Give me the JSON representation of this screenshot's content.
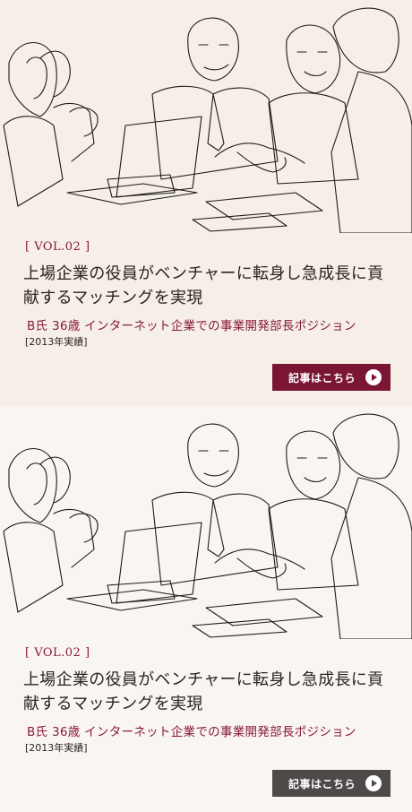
{
  "colors": {
    "accent": "#8a1a3a",
    "button_primary": "#7a1634",
    "button_secondary": "#4f4a49"
  },
  "cards": [
    {
      "vol": "[ VOL.02 ]",
      "title": "上場企業の役員がベンチャーに転身し急成長に貢献するマッチングを実現",
      "subtitle": "B氏 36歳 インターネット企業での事業開発部長ポジション",
      "year": "[2013年実績]",
      "button": "記事はこちら",
      "icon": "play-circle-icon"
    },
    {
      "vol": "[ VOL.02 ]",
      "title": "上場企業の役員がベンチャーに転身し急成長に貢献するマッチングを実現",
      "subtitle": "B氏 36歳 インターネット企業での事業開発部長ポジション",
      "year": "[2013年実績]",
      "button": "記事はこちら",
      "icon": "play-circle-icon"
    }
  ]
}
